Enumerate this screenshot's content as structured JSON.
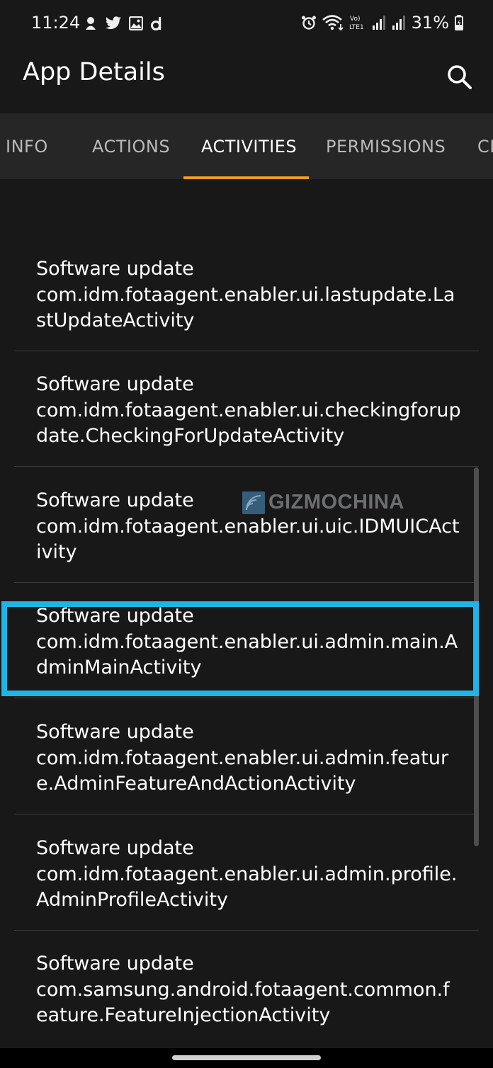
{
  "status_bar": {
    "time": "11:24",
    "battery_percent": "31%",
    "left_icons": [
      "notification-icon",
      "twitter-icon",
      "gallery-icon",
      "app-d-icon"
    ],
    "right_icons": [
      "alarm-icon",
      "wifi-icon",
      "volte-icon",
      "signal-icon",
      "signal-icon",
      "battery-charging-icon"
    ]
  },
  "app_bar": {
    "title": "App Details",
    "search_icon": "search-icon"
  },
  "tabs": [
    {
      "label": "INFO",
      "active": false
    },
    {
      "label": "ACTIONS",
      "active": false
    },
    {
      "label": "ACTIVITIES",
      "active": true
    },
    {
      "label": "PERMISSIONS",
      "active": false
    },
    {
      "label": "CE",
      "active": false
    }
  ],
  "activities": [
    {
      "label": "Software update",
      "name": "com.idm.fotaagent.enabler.ui.lastupdate.LastUpdateActivity"
    },
    {
      "label": "Software update",
      "name": "com.idm.fotaagent.enabler.ui.checkingforupdate.CheckingForUpdateActivity"
    },
    {
      "label": "Software update",
      "name": "com.idm.fotaagent.enabler.ui.uic.IDMUICActivity"
    },
    {
      "label": "Software update",
      "name": "com.idm.fotaagent.enabler.ui.admin.main.AdminMainActivity"
    },
    {
      "label": "Software update",
      "name": "com.idm.fotaagent.enabler.ui.admin.feature.AdminFeatureAndActionActivity"
    },
    {
      "label": "Software update",
      "name": "com.idm.fotaagent.enabler.ui.admin.profile.AdminProfileActivity"
    },
    {
      "label": "Software update",
      "name": "com.samsung.android.fotaagent.common.feature.FeatureInjectionActivity"
    }
  ],
  "watermark": {
    "text": "GIZMOCHINA"
  },
  "colors": {
    "background": "#181818",
    "tab_bar": "#262626",
    "tab_indicator": "#f29d1c",
    "highlight_box": "#1eb5e6",
    "divider": "#3b3b3b"
  }
}
